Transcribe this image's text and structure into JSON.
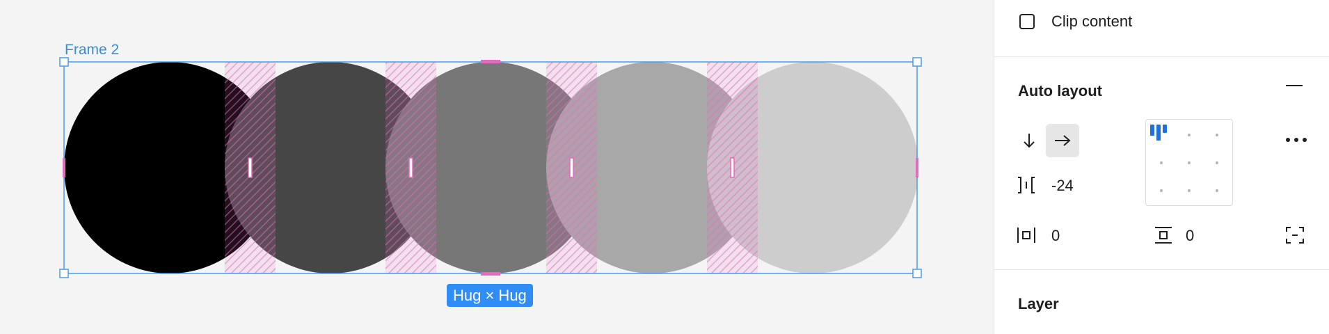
{
  "canvas": {
    "frame_label": "Frame 2",
    "size_badge": "Hug × Hug",
    "circle_fills": [
      "#000000",
      "#464646",
      "#777777",
      "#a8a8a8",
      "#cdcdcd"
    ],
    "selection_color": "#4a9be8",
    "spacing_color": "#e26bbd"
  },
  "panel": {
    "clip_content_label": "Clip content",
    "clip_content_checked": false,
    "auto_layout_title": "Auto layout",
    "direction_active": "horizontal",
    "gap_value": "-24",
    "horizontal_padding_value": "0",
    "vertical_padding_value": "0",
    "alignment": "top-left",
    "layer_title": "Layer"
  }
}
